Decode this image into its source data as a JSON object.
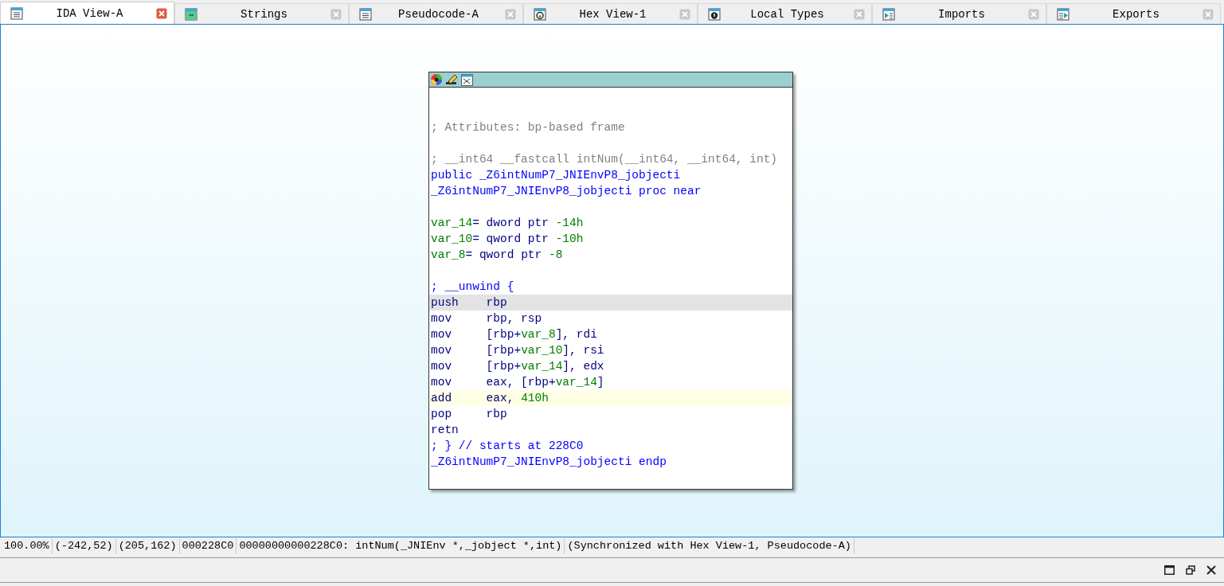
{
  "tabs": [
    {
      "label": "IDA View-A",
      "kind": "listing",
      "selected": true
    },
    {
      "label": "Strings",
      "kind": "strings",
      "selected": false
    },
    {
      "label": "Pseudocode-A",
      "kind": "listing",
      "selected": false
    },
    {
      "label": "Hex View-1",
      "kind": "hex",
      "selected": false
    },
    {
      "label": "Local Types",
      "kind": "types",
      "selected": false
    },
    {
      "label": "Imports",
      "kind": "imports",
      "selected": false
    },
    {
      "label": "Exports",
      "kind": "exports",
      "selected": false
    }
  ],
  "node": {
    "lines": [
      {
        "kind": "blank"
      },
      {
        "kind": "blank"
      },
      {
        "kind": "code",
        "selected": false,
        "marked": false,
        "segments": [
          {
            "t": "; Attributes: bp-based frame",
            "kind": "comment"
          }
        ]
      },
      {
        "kind": "blank"
      },
      {
        "kind": "code",
        "selected": false,
        "marked": false,
        "segments": [
          {
            "t": "; __int64 __fastcall intNum(__int64, __int64, int)",
            "kind": "comment"
          }
        ]
      },
      {
        "kind": "code",
        "selected": false,
        "marked": false,
        "segments": [
          {
            "t": "public _Z6intNumP7_JNIEnvP8_jobjecti",
            "kind": "name"
          }
        ]
      },
      {
        "kind": "code",
        "selected": false,
        "marked": false,
        "segments": [
          {
            "t": "_Z6intNumP7_JNIEnvP8_jobjecti proc near",
            "kind": "name"
          }
        ]
      },
      {
        "kind": "blank"
      },
      {
        "kind": "code",
        "selected": false,
        "marked": false,
        "segments": [
          {
            "t": "var_14",
            "kind": "var"
          },
          {
            "t": "= dword ptr ",
            "kind": "insn"
          },
          {
            "t": "-14h",
            "kind": "number"
          }
        ]
      },
      {
        "kind": "code",
        "selected": false,
        "marked": false,
        "segments": [
          {
            "t": "var_10",
            "kind": "var"
          },
          {
            "t": "= qword ptr ",
            "kind": "insn"
          },
          {
            "t": "-10h",
            "kind": "number"
          }
        ]
      },
      {
        "kind": "code",
        "selected": false,
        "marked": false,
        "segments": [
          {
            "t": "var_8",
            "kind": "var"
          },
          {
            "t": "= qword ptr ",
            "kind": "insn"
          },
          {
            "t": "-8",
            "kind": "number"
          }
        ]
      },
      {
        "kind": "blank"
      },
      {
        "kind": "code",
        "selected": false,
        "marked": false,
        "segments": [
          {
            "t": "; __unwind {",
            "kind": "name"
          }
        ]
      },
      {
        "kind": "code",
        "selected": true,
        "marked": false,
        "mnemonic": "push",
        "segments": [
          {
            "t": "rbp",
            "kind": "insn"
          }
        ]
      },
      {
        "kind": "code",
        "selected": false,
        "marked": false,
        "mnemonic": "mov",
        "segments": [
          {
            "t": "rbp, rsp",
            "kind": "insn"
          }
        ]
      },
      {
        "kind": "code",
        "selected": false,
        "marked": false,
        "mnemonic": "mov",
        "segments": [
          {
            "t": "[rbp+",
            "kind": "insn"
          },
          {
            "t": "var_8",
            "kind": "var"
          },
          {
            "t": "], rdi",
            "kind": "insn"
          }
        ]
      },
      {
        "kind": "code",
        "selected": false,
        "marked": false,
        "mnemonic": "mov",
        "segments": [
          {
            "t": "[rbp+",
            "kind": "insn"
          },
          {
            "t": "var_10",
            "kind": "var"
          },
          {
            "t": "], rsi",
            "kind": "insn"
          }
        ]
      },
      {
        "kind": "code",
        "selected": false,
        "marked": false,
        "mnemonic": "mov",
        "segments": [
          {
            "t": "[rbp+",
            "kind": "insn"
          },
          {
            "t": "var_14",
            "kind": "var"
          },
          {
            "t": "], edx",
            "kind": "insn"
          }
        ]
      },
      {
        "kind": "code",
        "selected": false,
        "marked": false,
        "mnemonic": "mov",
        "segments": [
          {
            "t": "eax, [rbp+",
            "kind": "insn"
          },
          {
            "t": "var_14",
            "kind": "var"
          },
          {
            "t": "]",
            "kind": "insn"
          }
        ]
      },
      {
        "kind": "code",
        "selected": false,
        "marked": true,
        "mnemonic": "add",
        "segments": [
          {
            "t": "eax, ",
            "kind": "insn"
          },
          {
            "t": "410h",
            "kind": "number"
          }
        ]
      },
      {
        "kind": "code",
        "selected": false,
        "marked": false,
        "mnemonic": "pop",
        "segments": [
          {
            "t": "rbp",
            "kind": "insn"
          }
        ]
      },
      {
        "kind": "code",
        "selected": false,
        "marked": false,
        "segments": [
          {
            "t": "retn",
            "kind": "insn"
          }
        ]
      },
      {
        "kind": "code",
        "selected": false,
        "marked": false,
        "segments": [
          {
            "t": "; } // starts at 228C0",
            "kind": "name"
          }
        ]
      },
      {
        "kind": "code",
        "selected": false,
        "marked": false,
        "segments": [
          {
            "t": "_Z6intNumP7_JNIEnvP8_jobjecti endp",
            "kind": "name"
          }
        ]
      },
      {
        "kind": "blank"
      }
    ]
  },
  "status_bar": [
    "100.00%",
    "(-242,52)",
    "(205,162)",
    "000228C0",
    "00000000000228C0: intNum(_JNIEnv *,_jobject *,int)",
    "(Synchronized with Hex View-1, Pseudocode-A)"
  ]
}
